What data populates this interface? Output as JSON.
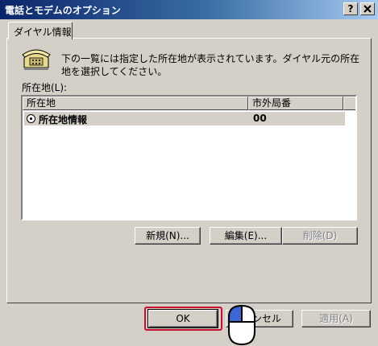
{
  "window": {
    "title": "電話とモデムのオプション",
    "help_button": "?",
    "close_button": "X"
  },
  "tabs": [
    {
      "label": "ダイヤル情報"
    }
  ],
  "panel": {
    "description": "下の一覧には指定した所在地が表示されています。ダイヤル元の所在地を選択してください。",
    "locations_label": "所在地(L):",
    "columns": [
      "所在地",
      "市外局番"
    ],
    "rows": [
      {
        "location": "所在地情報",
        "area_code": "00",
        "selected": true
      }
    ],
    "buttons": {
      "new": "新規(N)...",
      "edit": "編集(E)...",
      "delete": "削除(D)"
    }
  },
  "footer": {
    "ok": "OK",
    "cancel": "ンセル",
    "apply": "適用(A)"
  },
  "colors": {
    "title_start": "#0a246a",
    "title_end": "#a6caf0",
    "highlight": "#c8102e",
    "face": "#d4d0c8"
  },
  "icons": [
    "phone-icon",
    "radio-selected-icon",
    "mouse-cursor-icon"
  ]
}
